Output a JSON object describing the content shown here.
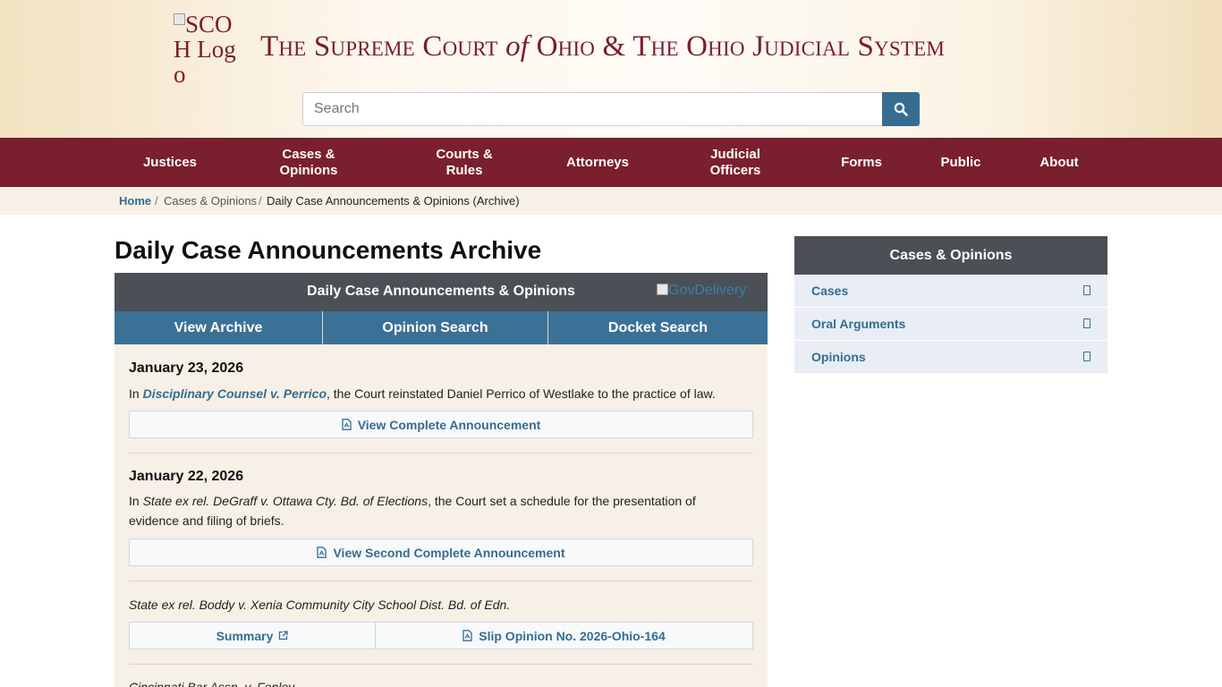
{
  "header": {
    "logo_alt": "SCOH Logo",
    "title_parts": {
      "the1": "The Supreme Court",
      "of": "of",
      "rest": "Ohio & The Ohio Judicial System"
    },
    "search_placeholder": "Search"
  },
  "nav": {
    "items": [
      {
        "label": "Justices"
      },
      {
        "label": "Cases & Opinions"
      },
      {
        "label": "Courts & Rules"
      },
      {
        "label": "Attorneys"
      },
      {
        "label": "Judicial Officers"
      },
      {
        "label": "Forms"
      },
      {
        "label": "Public"
      },
      {
        "label": "About"
      }
    ]
  },
  "breadcrumb": {
    "home": "Home",
    "sep": "/",
    "parent": "Cases & Opinions",
    "current": "Daily Case Announcements & Opinions (Archive)"
  },
  "main": {
    "title": "Daily Case Announcements Archive",
    "panel_title": "Daily Case Announcements & Opinions",
    "govdelivery_alt": "GovDelivery",
    "tabs": [
      {
        "label": "View Archive"
      },
      {
        "label": "Opinion Search"
      },
      {
        "label": "Docket Search"
      }
    ],
    "entries": [
      {
        "date": "January 23, 2026",
        "pre": "In ",
        "case": "Disciplinary Counsel v. Perrico",
        "post": ", the Court reinstated Daniel Perrico of Westlake to the practice of law.",
        "button": "View Complete Announcement"
      },
      {
        "date": "January 22, 2026",
        "pre": "In ",
        "case": "State ex rel. DeGraff v. Ottawa Cty. Bd. of Elections",
        "post": ", the Court set a schedule for the presentation of evidence and filing of briefs.",
        "button": "View Second Complete Announcement"
      }
    ],
    "opinion": {
      "case": "State ex rel. Boddy v. Xenia Community City School Dist. Bd. of Edn.",
      "summary": "Summary",
      "slip": "Slip Opinion No. 2026-Ohio-164"
    },
    "next_case_partial": "Cincinnati Bar Assn. v. Fenley"
  },
  "sidebar": {
    "title": "Cases & Opinions",
    "items": [
      {
        "label": "Cases"
      },
      {
        "label": "Oral Arguments"
      },
      {
        "label": "Opinions"
      }
    ]
  },
  "colors": {
    "burgundy": "#7a1f2d",
    "blue": "#356d91",
    "panel_gray": "#4a5055",
    "cream": "#f6f0e6"
  }
}
